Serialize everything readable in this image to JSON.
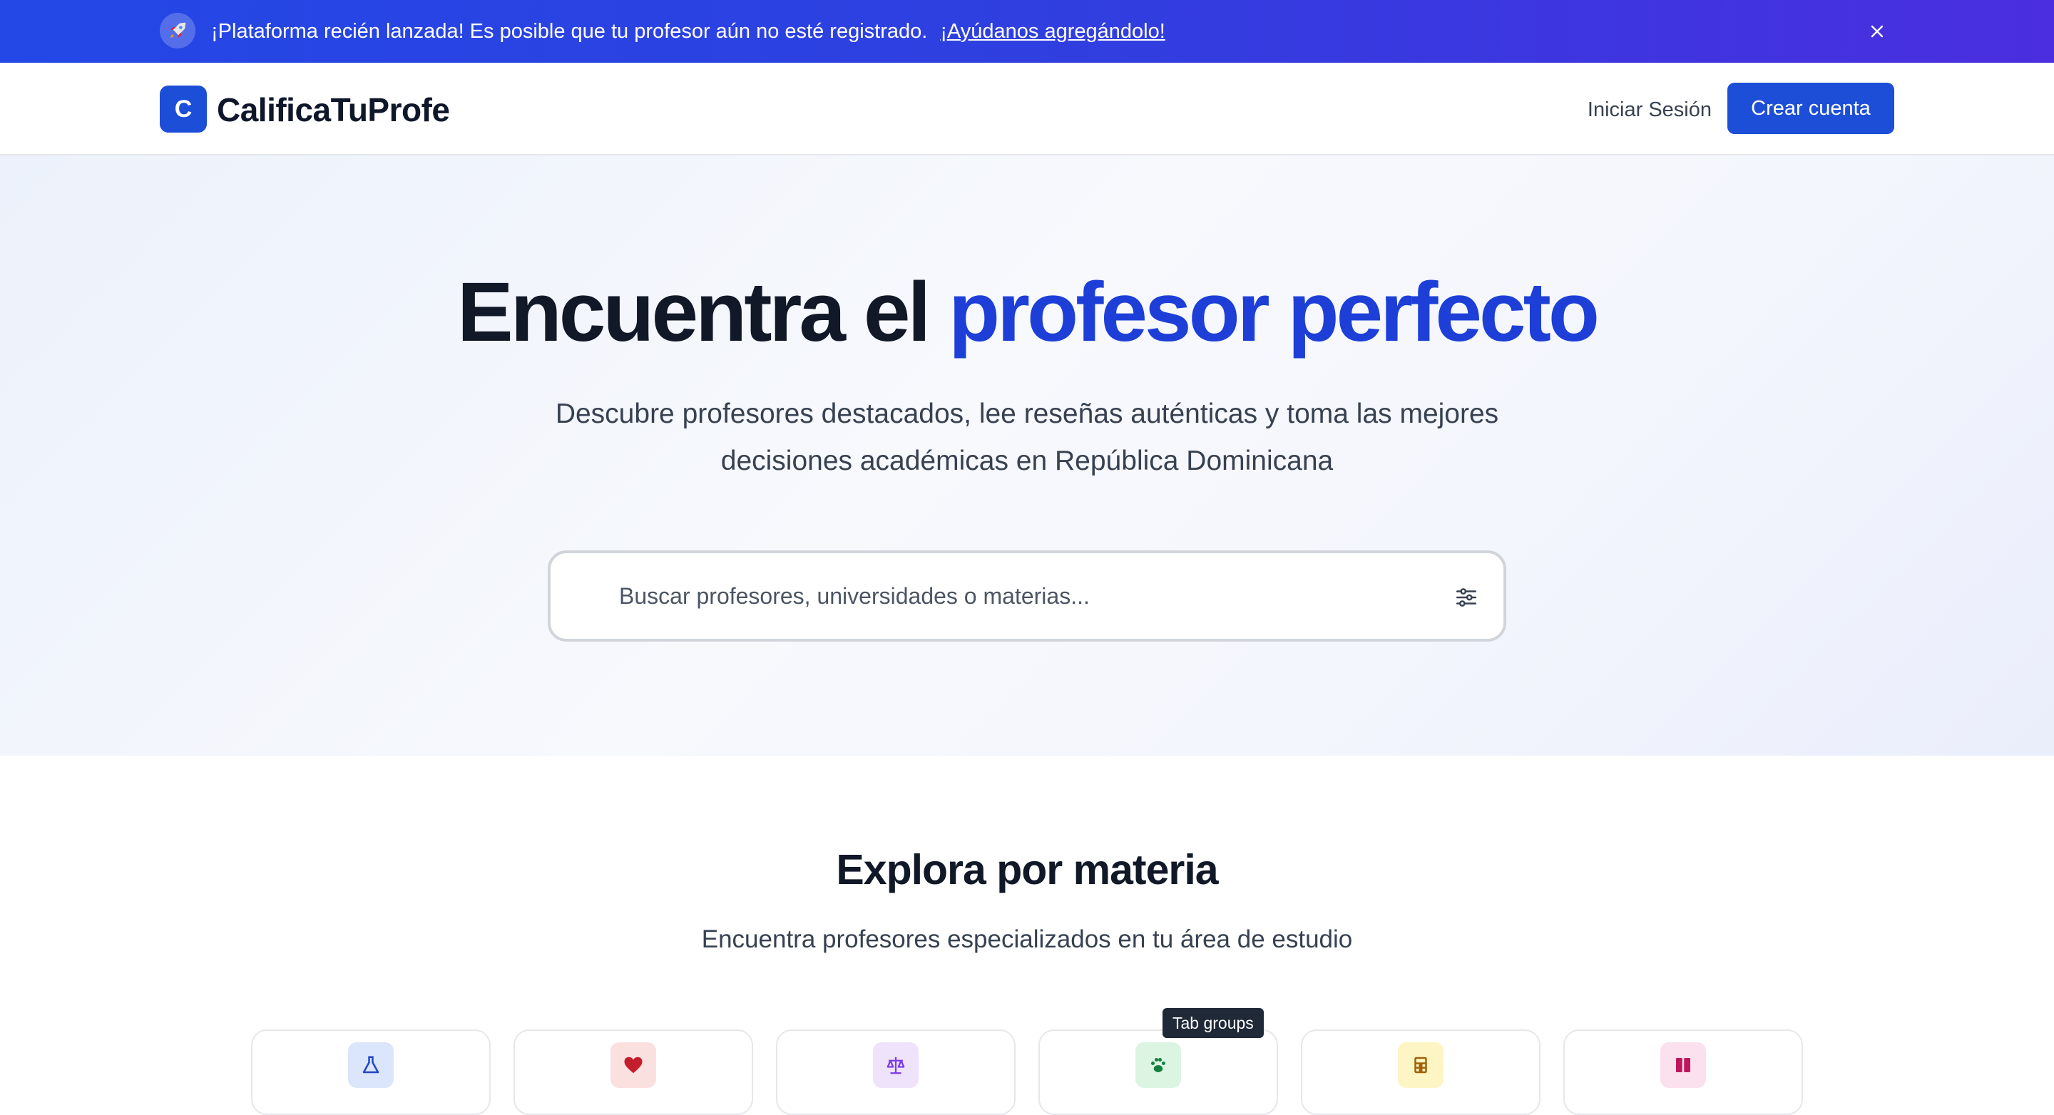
{
  "banner": {
    "icon": "rocket-icon",
    "text": "¡Plataforma recién lanzada! Es posible que tu profesor aún no esté registrado.",
    "link": "¡Ayúdanos agregándolo!",
    "close_icon": "close-icon"
  },
  "header": {
    "logo_letter": "C",
    "brand": "CalificaTuProfe",
    "login": "Iniciar Sesión",
    "signup": "Crear cuenta"
  },
  "hero": {
    "title_plain": "Encuentra el",
    "title_accent": "profesor perfecto",
    "subtitle": "Descubre profesores destacados, lee reseñas auténticas y toma las mejores decisiones académicas en República Dominicana",
    "search_placeholder": "Buscar profesores, universidades o materias...",
    "search_value": "",
    "filter_icon": "sliders-icon"
  },
  "explore": {
    "title": "Explora por materia",
    "subtitle": "Encuentra profesores especializados en tu área de estudio",
    "categories": [
      {
        "icon": "flask-icon",
        "bg": "#dbe5fb",
        "color": "#2146c7"
      },
      {
        "icon": "heart-icon",
        "bg": "#fbe0e0",
        "color": "#c41d2d"
      },
      {
        "icon": "scale-icon",
        "bg": "#efe3fb",
        "color": "#7c3aed"
      },
      {
        "icon": "paw-icon",
        "bg": "#dcf5e3",
        "color": "#15803d"
      },
      {
        "icon": "calculator-icon",
        "bg": "#fdf5c4",
        "color": "#a16207"
      },
      {
        "icon": "book-icon",
        "bg": "#fbe0ee",
        "color": "#be185d"
      }
    ]
  },
  "tooltip": {
    "text": "Tab groups"
  },
  "colors": {
    "primary": "#1d4ed8",
    "accent_title": "#1d3fd8",
    "banner_start": "#2348e6",
    "banner_end": "#4a2ee0"
  }
}
